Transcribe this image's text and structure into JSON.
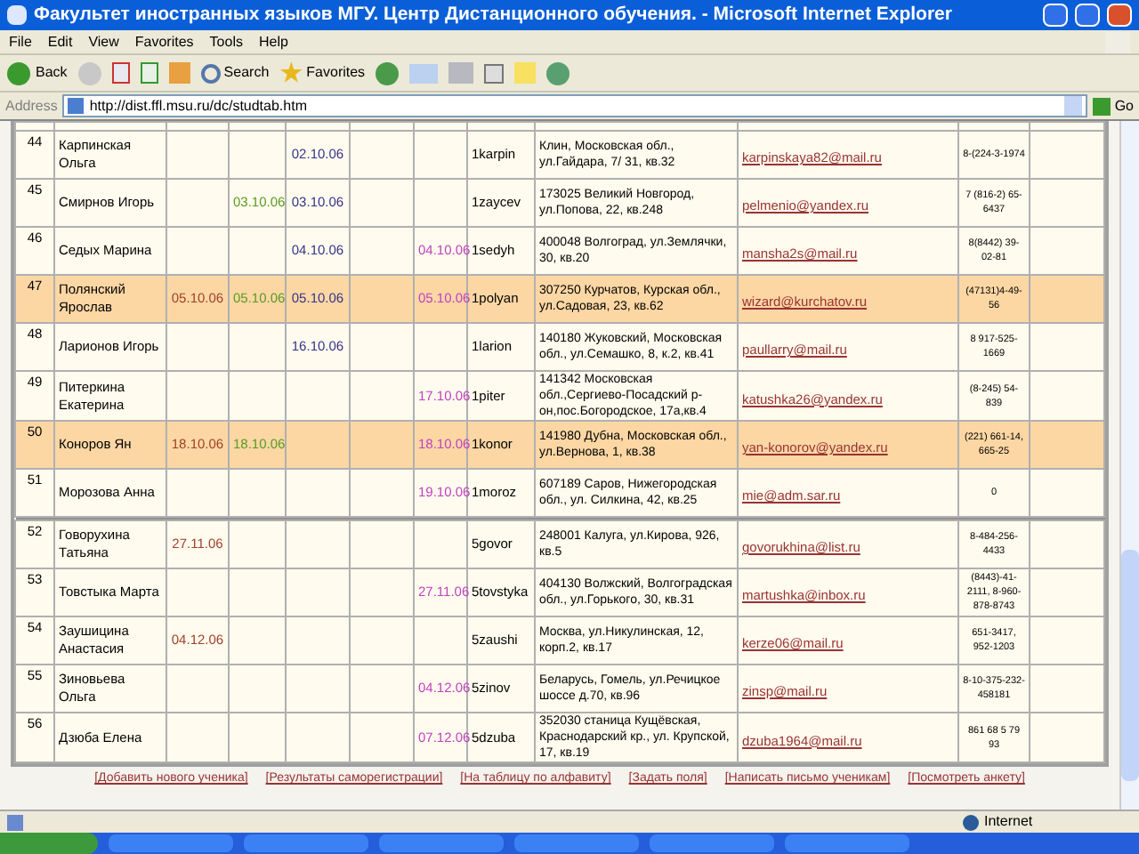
{
  "window": {
    "title": "Факультет иностранных языков МГУ. Центр Дистанционного обучения. - Microsoft Internet Explorer"
  },
  "menu": [
    "File",
    "Edit",
    "View",
    "Favorites",
    "Tools",
    "Help"
  ],
  "toolbar": {
    "back": "Back",
    "search": "Search",
    "favorites": "Favorites"
  },
  "address_bar": {
    "label": "Address",
    "url": "http://dist.ffl.msu.ru/dc/studtab.htm",
    "go": "Go"
  },
  "table": {
    "rows": [
      {
        "highlighted": false,
        "num": "44",
        "name": "Карпинская Ольга",
        "date_3": "02.10.06",
        "login": "1karpin",
        "address": "Клин, Московская обл., ул.Гайдара, 7/ 31, кв.32",
        "email": "karpinskaya82@mail.ru",
        "phone": "8-(224-3-1974"
      },
      {
        "highlighted": false,
        "num": "45",
        "name": "Смирнов Игорь",
        "date_2": "03.10.06",
        "date_3": "03.10.06",
        "login": "1zaycev",
        "address": "173025 Великий Новгород, ул.Попова, 22, кв.248",
        "email": "pelmenio@yandex.ru",
        "phone": "7 (816-2) 65-6437"
      },
      {
        "highlighted": false,
        "num": "46",
        "name": "Седых Марина",
        "date_3": "04.10.06",
        "date_5": "04.10.06",
        "login": "1sedyh",
        "address": "400048 Волгоград, ул.Землячки, 30, кв.20",
        "email": "mansha2s@mail.ru",
        "phone": "8(8442) 39-02-81"
      },
      {
        "highlighted": true,
        "num": "47",
        "name": "Полянский Ярослав",
        "date_1": "05.10.06",
        "date_2": "05.10.06",
        "date_3": "05.10.06",
        "date_5": "05.10.06",
        "login": "1polyan",
        "address": "307250 Курчатов, Курская обл., ул.Садовая, 23, кв.62",
        "email": "wizard@kurchatov.ru",
        "phone": "(47131)4-49-56"
      },
      {
        "highlighted": false,
        "num": "48",
        "name": "Ларионов Игорь",
        "date_3": "16.10.06",
        "login": "1larion",
        "address": "140180 Жуковский, Московская обл., ул.Семашко, 8, к.2, кв.41",
        "email": "paullarry@mail.ru",
        "phone": "8 917-525-1669"
      },
      {
        "highlighted": false,
        "num": "49",
        "name": "Питеркина Екатерина",
        "date_5": "17.10.06",
        "login": "1piter",
        "address": "141342 Московская обл.,Сергиево-Посадский р-он,пос.Богородское, 17а,кв.4",
        "email": "katushka26@yandex.ru",
        "phone": "(8-245) 54-839"
      },
      {
        "highlighted": true,
        "num": "50",
        "name": "Коноров Ян",
        "date_1": "18.10.06",
        "date_2": "18.10.06",
        "date_5": "18.10.06",
        "login": "1konor",
        "address": "141980 Дубна, Московская обл., ул.Вернова, 1, кв.38",
        "email": "yan-konorov@yandex.ru",
        "phone": "(221) 661-14, 665-25"
      },
      {
        "highlighted": false,
        "num": "51",
        "name": "Морозова Анна",
        "date_5": "19.10.06",
        "login": "1moroz",
        "address": "607189 Саров, Нижегородская обл., ул. Силкина, 42, кв.25",
        "email": "mie@adm.sar.ru",
        "phone": "0"
      },
      {
        "highlighted": false,
        "num": "52",
        "name": "Говорухина Татьяна",
        "date_1": "27.11.06",
        "login": "5govor",
        "address": "248001 Калуга, ул.Кирова, 926, кв.5",
        "email": "govorukhina@list.ru",
        "phone": "8-484-256-4433"
      },
      {
        "highlighted": false,
        "num": "53",
        "name": "Товстыка Марта",
        "date_5": "27.11.06",
        "login": "5tovstyka",
        "address": "404130 Волжский, Волгоградская обл., ул.Горького, 30, кв.31",
        "email": "martushka@inbox.ru",
        "phone": "(8443)-41-2111, 8-960-878-8743"
      },
      {
        "highlighted": false,
        "num": "54",
        "name": "Заушицина Анастасия",
        "date_1": "04.12.06",
        "login": "5zaushi",
        "address": "Москва, ул.Никулинская, 12, корп.2, кв.17",
        "email": "kerze06@mail.ru",
        "phone": "651-3417, 952-1203"
      },
      {
        "highlighted": false,
        "num": "55",
        "name": "Зиновьева Ольга",
        "date_5": "04.12.06",
        "login": "5zinov",
        "address": "Беларусь, Гомель, ул.Речицкое шоссе д.70, кв.96",
        "email": "zinsp@mail.ru",
        "phone": "8-10-375-232-458181"
      },
      {
        "highlighted": false,
        "num": "56",
        "name": "Дзюба Елена",
        "date_5": "07.12.06",
        "login": "5dzuba",
        "address": "352030 станица Кущёвская, Краснодарский кр., ул. Крупской, 17, кв.19",
        "email": "dzuba1964@mail.ru",
        "phone": "861 68 5 79 93"
      }
    ]
  },
  "links": [
    "[Добавить нового ученика]",
    "[Результаты саморегистрации]",
    "[На таблицу по алфавиту]",
    "[Задать поля]",
    "[Написать письмо ученикам]",
    "[Посмотреть анкету]"
  ],
  "status_bar": {
    "zone": "Internet"
  }
}
